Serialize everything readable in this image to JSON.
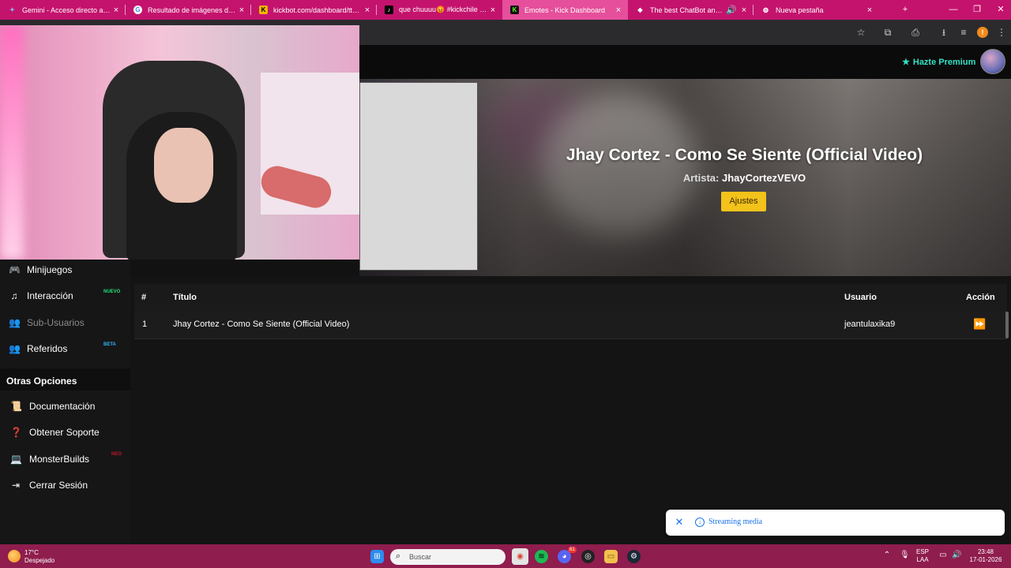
{
  "browser": {
    "tabs": [
      {
        "title": "Gemini - Acceso directo a la IA",
        "active": false
      },
      {
        "title": "Resultado de imágenes de Goo",
        "active": false
      },
      {
        "title": "kickbot.com/dashboard/tts/se",
        "active": false
      },
      {
        "title": "que chuuuu😡 #kickchile #str",
        "active": false
      },
      {
        "title": "Emotes - Kick Dashboard",
        "active": true
      },
      {
        "title": "The best ChatBot and Widg",
        "active": false
      },
      {
        "title": "Nueva pestaña",
        "active": false
      }
    ],
    "profile_initial": "!"
  },
  "header": {
    "premium_label": "Hazte Premium"
  },
  "hero": {
    "title": "Jhay Cortez - Como Se Siente (Official Video)",
    "artist_label": "Artista:",
    "artist_value": "JhayCortezVEVO",
    "settings_button": "Ajustes"
  },
  "sidebar": {
    "items": [
      {
        "label": "Minijuegos",
        "icon": "gamepad-icon",
        "badge": ""
      },
      {
        "label": "Interacción",
        "icon": "music-note-icon",
        "badge": "NUEVO"
      },
      {
        "label": "Sub-Usuarios",
        "icon": "users-icon",
        "badge": ""
      },
      {
        "label": "Referidos",
        "icon": "people-icon",
        "badge": "BETA"
      }
    ],
    "section_title": "Otras Opciones",
    "other_items": [
      {
        "label": "Documentación",
        "icon": "scroll-icon",
        "badge": ""
      },
      {
        "label": "Obtener Soporte",
        "icon": "question-icon",
        "badge": ""
      },
      {
        "label": "MonsterBuilds",
        "icon": "laptop-icon",
        "badge": "NEO"
      },
      {
        "label": "Cerrar Sesión",
        "icon": "logout-icon",
        "badge": ""
      }
    ]
  },
  "table": {
    "headers": {
      "num": "#",
      "title": "Título",
      "user": "Usuario",
      "action": "Acción"
    },
    "rows": [
      {
        "num": "1",
        "title": "Jhay Cortez - Como Se Siente (Official Video)",
        "user": "jeantulaxika9"
      }
    ]
  },
  "toast": {
    "text": "Streaming media"
  },
  "taskbar": {
    "weather_temp": "17°C",
    "weather_desc": "Despejado",
    "search_placeholder": "Buscar",
    "lang_top": "ESP",
    "lang_bottom": "LAA",
    "time": "23:48",
    "date": "17-01-2026",
    "discord_badge": "61"
  },
  "colors": {
    "tabbar": "#c4136d",
    "accent_premium": "#35e0c5",
    "ajustes_button": "#f3c21b",
    "badge_new": "#22e07a",
    "badge_beta": "#2fb4ff",
    "taskbar": "#8f1d4d"
  }
}
